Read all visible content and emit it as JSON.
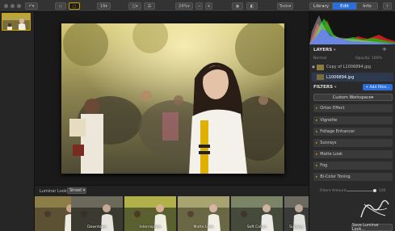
{
  "toolbar": {
    "zoom_preset": "16",
    "zoom_value": "24%",
    "tools_label": "Tools",
    "tabs": [
      {
        "label": "Library"
      },
      {
        "label": "Edit"
      },
      {
        "label": "Info"
      }
    ],
    "active_tab": "Edit"
  },
  "layers": {
    "title": "LAYERS",
    "header_left": "Normal",
    "header_right": "Opacity: 100%",
    "items": [
      {
        "label": "Copy of L1006894.jpg"
      },
      {
        "label": "L1006894.jpg"
      }
    ]
  },
  "filters": {
    "title": "FILTERS",
    "add_label": "+ Add Filter...",
    "workspace_label": "Custom Workspace",
    "items": [
      {
        "label": "Orton Effect"
      },
      {
        "label": "Vignette"
      },
      {
        "label": "Foliage Enhancer"
      },
      {
        "label": "Sunrays"
      },
      {
        "label": "Matte Look"
      },
      {
        "label": "Fog"
      },
      {
        "label": "Bi-Color Toning"
      }
    ],
    "amount_label": "Filters Amount",
    "amount_value": "100",
    "amount_fraction": 1.0
  },
  "looks": {
    "label": "Luminar Looks:",
    "category": "Street",
    "items": [
      {
        "label": ""
      },
      {
        "label": "Downtown"
      },
      {
        "label": "Interception"
      },
      {
        "label": "Matte Look"
      },
      {
        "label": "Soft Colors"
      },
      {
        "label": "Subway"
      }
    ]
  },
  "save_look_label": "Save Luminar Look...",
  "colors": {
    "accent": "#2c6ed8",
    "selection": "#c9a400"
  },
  "icons": [
    "undo-icon",
    "preview-icon",
    "compare-icon",
    "zoom-out-icon",
    "zoom-in-icon",
    "eye-icon",
    "split-view-icon",
    "export-icon",
    "brush-icon",
    "sliders-icon"
  ]
}
